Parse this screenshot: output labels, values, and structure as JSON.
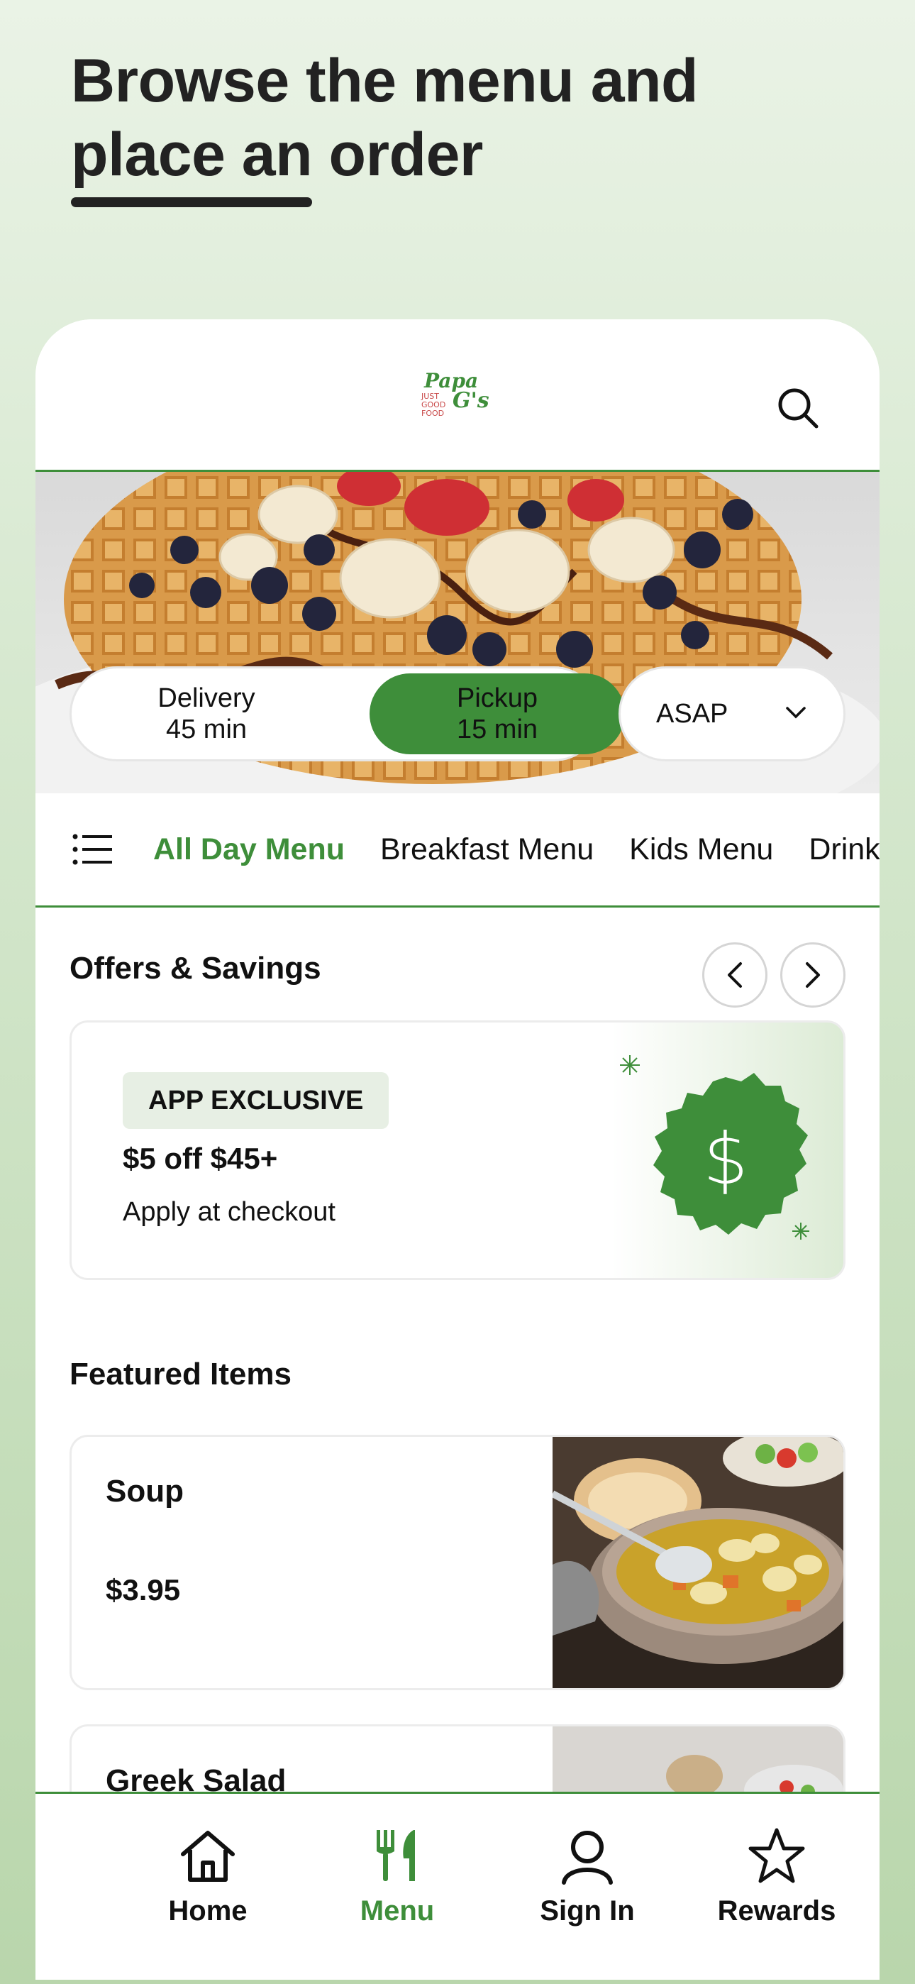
{
  "promo": {
    "headline_line1": "Browse the menu and",
    "headline_line2": "place an order"
  },
  "header": {
    "logo_text_top": "Papa G's",
    "logo_text_bottom": "JUST GOOD FOOD"
  },
  "order_mode": {
    "delivery_label": "Delivery",
    "delivery_time": "45 min",
    "pickup_label": "Pickup",
    "pickup_time": "15 min",
    "selected": "pickup",
    "time_select": "ASAP"
  },
  "categories": {
    "tabs": [
      "All Day Menu",
      "Breakfast Menu",
      "Kids Menu",
      "Drinks"
    ],
    "active": "All Day Menu"
  },
  "offers": {
    "title": "Offers & Savings",
    "card": {
      "badge": "APP EXCLUSIVE",
      "title": "$5 off $45+",
      "subtitle": "Apply at checkout",
      "icon": "dollar-badge-icon"
    }
  },
  "featured": {
    "title": "Featured Items",
    "items": [
      {
        "name": "Soup",
        "price": "$3.95"
      },
      {
        "name": "Greek Salad",
        "price": ""
      }
    ]
  },
  "bottom_nav": {
    "items": [
      {
        "label": "Home",
        "icon": "home-icon"
      },
      {
        "label": "Menu",
        "icon": "fork-knife-icon"
      },
      {
        "label": "Sign In",
        "icon": "user-icon"
      },
      {
        "label": "Rewards",
        "icon": "star-icon"
      }
    ],
    "active": "Menu"
  },
  "colors": {
    "brand_green": "#3e8e3a",
    "text": "#111111"
  }
}
